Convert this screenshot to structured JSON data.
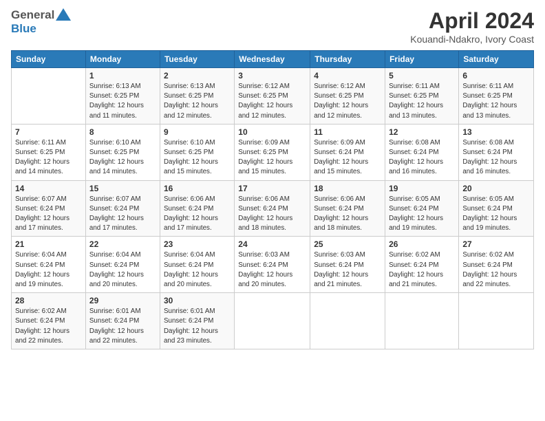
{
  "header": {
    "logo_general": "General",
    "logo_blue": "Blue",
    "title": "April 2024",
    "subtitle": "Kouandi-Ndakro, Ivory Coast"
  },
  "calendar": {
    "days_of_week": [
      "Sunday",
      "Monday",
      "Tuesday",
      "Wednesday",
      "Thursday",
      "Friday",
      "Saturday"
    ],
    "weeks": [
      [
        {
          "day": "",
          "info": ""
        },
        {
          "day": "1",
          "info": "Sunrise: 6:13 AM\nSunset: 6:25 PM\nDaylight: 12 hours\nand 11 minutes."
        },
        {
          "day": "2",
          "info": "Sunrise: 6:13 AM\nSunset: 6:25 PM\nDaylight: 12 hours\nand 12 minutes."
        },
        {
          "day": "3",
          "info": "Sunrise: 6:12 AM\nSunset: 6:25 PM\nDaylight: 12 hours\nand 12 minutes."
        },
        {
          "day": "4",
          "info": "Sunrise: 6:12 AM\nSunset: 6:25 PM\nDaylight: 12 hours\nand 12 minutes."
        },
        {
          "day": "5",
          "info": "Sunrise: 6:11 AM\nSunset: 6:25 PM\nDaylight: 12 hours\nand 13 minutes."
        },
        {
          "day": "6",
          "info": "Sunrise: 6:11 AM\nSunset: 6:25 PM\nDaylight: 12 hours\nand 13 minutes."
        }
      ],
      [
        {
          "day": "7",
          "info": "Sunrise: 6:11 AM\nSunset: 6:25 PM\nDaylight: 12 hours\nand 14 minutes."
        },
        {
          "day": "8",
          "info": "Sunrise: 6:10 AM\nSunset: 6:25 PM\nDaylight: 12 hours\nand 14 minutes."
        },
        {
          "day": "9",
          "info": "Sunrise: 6:10 AM\nSunset: 6:25 PM\nDaylight: 12 hours\nand 15 minutes."
        },
        {
          "day": "10",
          "info": "Sunrise: 6:09 AM\nSunset: 6:25 PM\nDaylight: 12 hours\nand 15 minutes."
        },
        {
          "day": "11",
          "info": "Sunrise: 6:09 AM\nSunset: 6:24 PM\nDaylight: 12 hours\nand 15 minutes."
        },
        {
          "day": "12",
          "info": "Sunrise: 6:08 AM\nSunset: 6:24 PM\nDaylight: 12 hours\nand 16 minutes."
        },
        {
          "day": "13",
          "info": "Sunrise: 6:08 AM\nSunset: 6:24 PM\nDaylight: 12 hours\nand 16 minutes."
        }
      ],
      [
        {
          "day": "14",
          "info": "Sunrise: 6:07 AM\nSunset: 6:24 PM\nDaylight: 12 hours\nand 17 minutes."
        },
        {
          "day": "15",
          "info": "Sunrise: 6:07 AM\nSunset: 6:24 PM\nDaylight: 12 hours\nand 17 minutes."
        },
        {
          "day": "16",
          "info": "Sunrise: 6:06 AM\nSunset: 6:24 PM\nDaylight: 12 hours\nand 17 minutes."
        },
        {
          "day": "17",
          "info": "Sunrise: 6:06 AM\nSunset: 6:24 PM\nDaylight: 12 hours\nand 18 minutes."
        },
        {
          "day": "18",
          "info": "Sunrise: 6:06 AM\nSunset: 6:24 PM\nDaylight: 12 hours\nand 18 minutes."
        },
        {
          "day": "19",
          "info": "Sunrise: 6:05 AM\nSunset: 6:24 PM\nDaylight: 12 hours\nand 19 minutes."
        },
        {
          "day": "20",
          "info": "Sunrise: 6:05 AM\nSunset: 6:24 PM\nDaylight: 12 hours\nand 19 minutes."
        }
      ],
      [
        {
          "day": "21",
          "info": "Sunrise: 6:04 AM\nSunset: 6:24 PM\nDaylight: 12 hours\nand 19 minutes."
        },
        {
          "day": "22",
          "info": "Sunrise: 6:04 AM\nSunset: 6:24 PM\nDaylight: 12 hours\nand 20 minutes."
        },
        {
          "day": "23",
          "info": "Sunrise: 6:04 AM\nSunset: 6:24 PM\nDaylight: 12 hours\nand 20 minutes."
        },
        {
          "day": "24",
          "info": "Sunrise: 6:03 AM\nSunset: 6:24 PM\nDaylight: 12 hours\nand 20 minutes."
        },
        {
          "day": "25",
          "info": "Sunrise: 6:03 AM\nSunset: 6:24 PM\nDaylight: 12 hours\nand 21 minutes."
        },
        {
          "day": "26",
          "info": "Sunrise: 6:02 AM\nSunset: 6:24 PM\nDaylight: 12 hours\nand 21 minutes."
        },
        {
          "day": "27",
          "info": "Sunrise: 6:02 AM\nSunset: 6:24 PM\nDaylight: 12 hours\nand 22 minutes."
        }
      ],
      [
        {
          "day": "28",
          "info": "Sunrise: 6:02 AM\nSunset: 6:24 PM\nDaylight: 12 hours\nand 22 minutes."
        },
        {
          "day": "29",
          "info": "Sunrise: 6:01 AM\nSunset: 6:24 PM\nDaylight: 12 hours\nand 22 minutes."
        },
        {
          "day": "30",
          "info": "Sunrise: 6:01 AM\nSunset: 6:24 PM\nDaylight: 12 hours\nand 23 minutes."
        },
        {
          "day": "",
          "info": ""
        },
        {
          "day": "",
          "info": ""
        },
        {
          "day": "",
          "info": ""
        },
        {
          "day": "",
          "info": ""
        }
      ]
    ]
  }
}
